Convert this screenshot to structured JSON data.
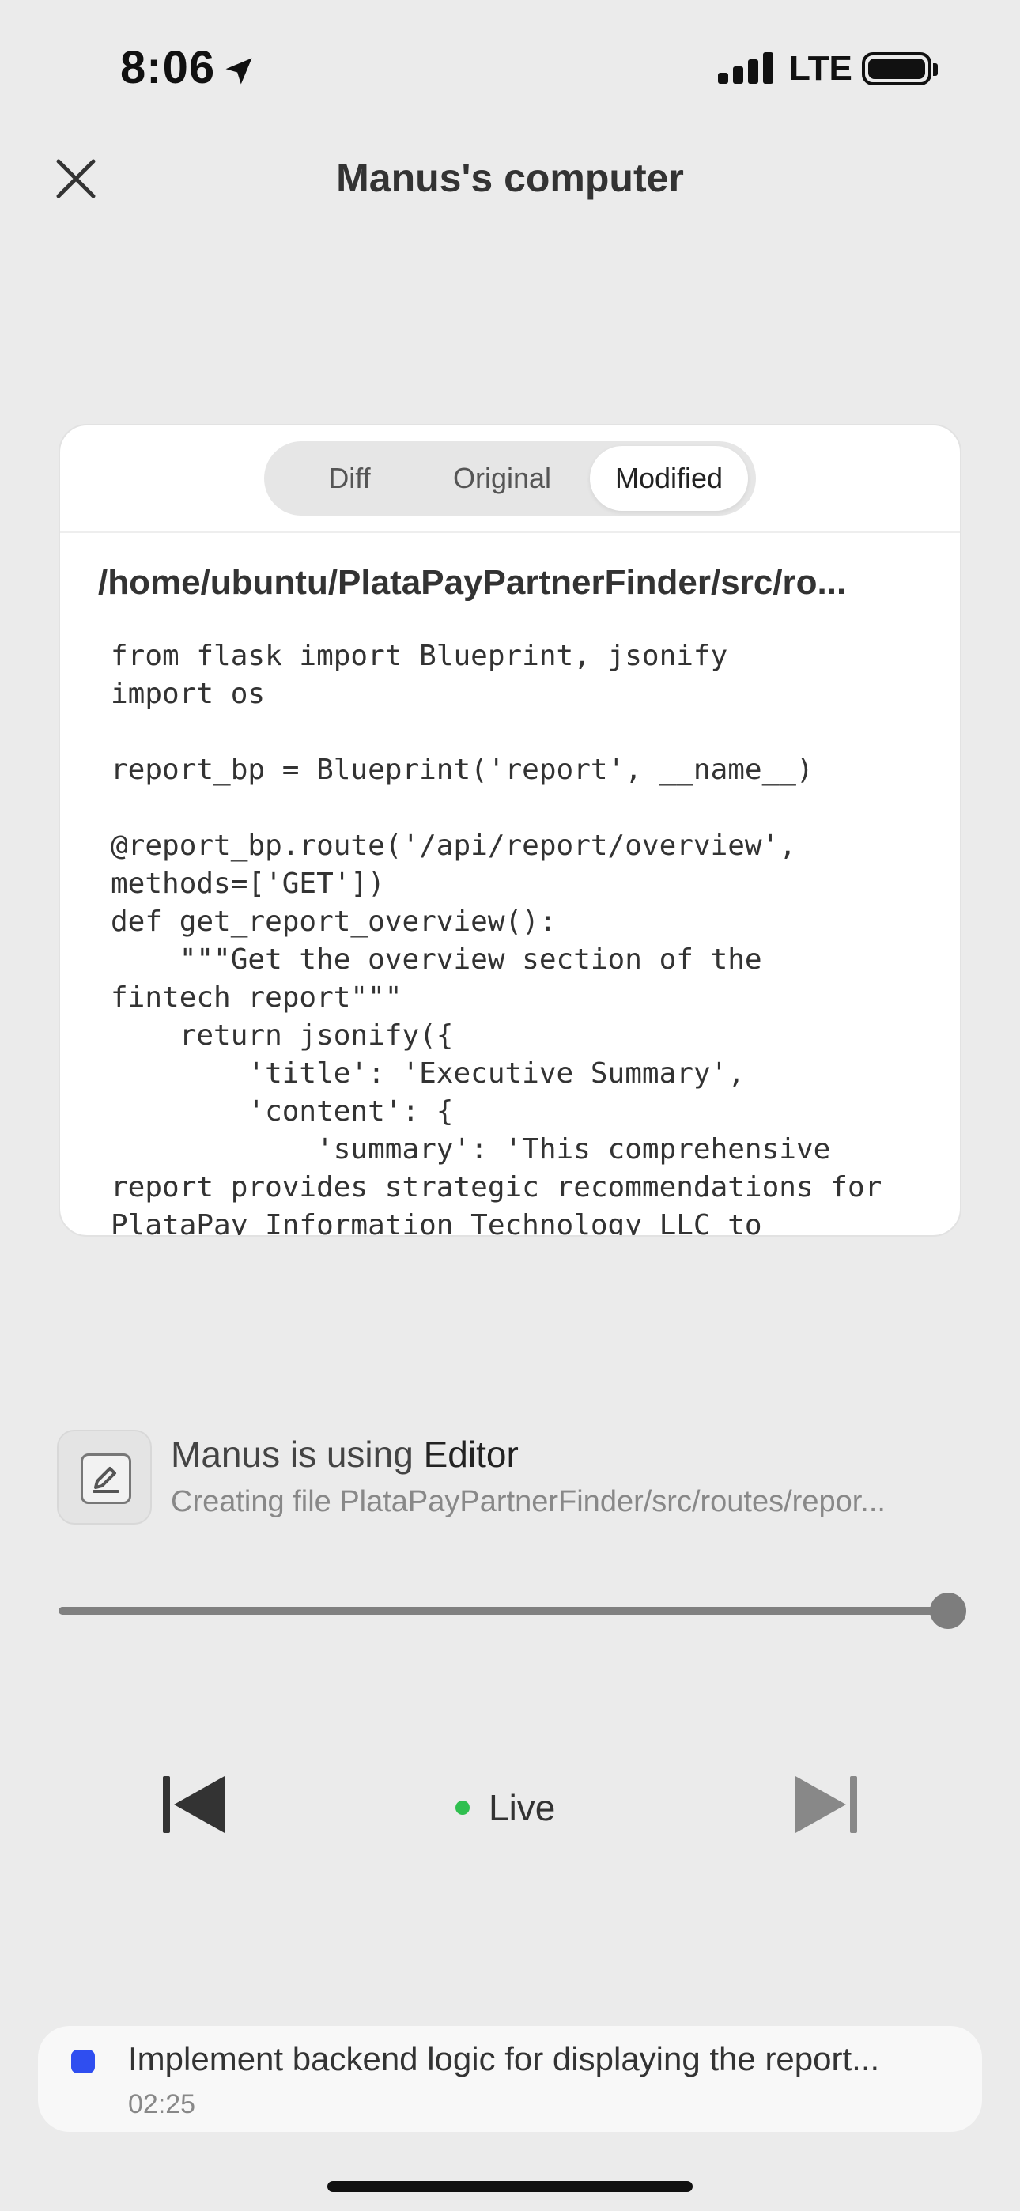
{
  "status_bar": {
    "time": "8:06",
    "network": "LTE",
    "icons": [
      "location-arrow-icon",
      "signal-icon",
      "battery-icon"
    ]
  },
  "header": {
    "title": "Manus's computer",
    "close_icon": "close-icon"
  },
  "editor": {
    "tabs": [
      {
        "label": "Diff",
        "active": false
      },
      {
        "label": "Original",
        "active": false
      },
      {
        "label": "Modified",
        "active": true
      }
    ],
    "file_path": "/home/ubuntu/PlataPayPartnerFinder/src/ro...",
    "code": "from flask import Blueprint, jsonify\nimport os\n\nreport_bp = Blueprint('report', __name__)\n\n@report_bp.route('/api/report/overview',\nmethods=['GET'])\ndef get_report_overview():\n    \"\"\"Get the overview section of the\nfintech report\"\"\"\n    return jsonify({\n        'title': 'Executive Summary',\n        'content': {\n            'summary': 'This comprehensive\nreport provides strategic recommendations for\nPlataPay Information Technology LLC to"
  },
  "tool": {
    "prefix": "Manus is using ",
    "name": "Editor",
    "action": "Creating file PlataPayPartnerFinder/src/routes/repor...",
    "icon": "edit-icon"
  },
  "playback": {
    "progress": 1.0,
    "live_label": "Live",
    "live_color": "#2fbf4f",
    "prev_icon": "skip-back-icon",
    "next_icon": "skip-forward-icon"
  },
  "task": {
    "title": "Implement backend logic for displaying the report...",
    "time": "02:25",
    "icon_color": "#2f4ef0"
  }
}
